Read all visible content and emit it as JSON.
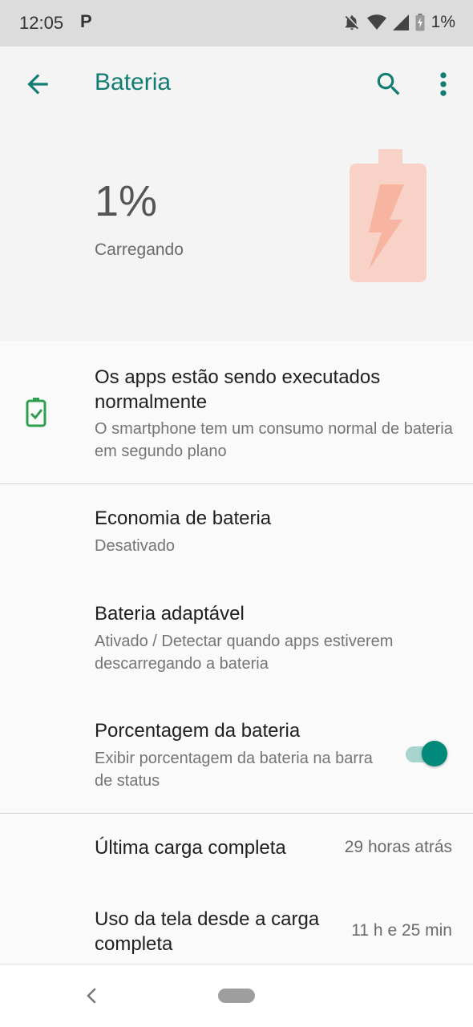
{
  "status_bar": {
    "time": "12:05",
    "notification_glyph": "P",
    "battery_text": "1%",
    "icons": [
      "notifications-off-icon",
      "wifi-icon",
      "signal-icon",
      "battery-charging-icon"
    ]
  },
  "app_bar": {
    "title": "Bateria",
    "back_icon": "arrow-back-icon",
    "search_icon": "search-icon",
    "more_icon": "more-vert-icon"
  },
  "hero": {
    "percent": "1%",
    "state": "Carregando",
    "battery_level": 0.01,
    "illustration_icon": "battery-charging-large-icon"
  },
  "tip": {
    "title": "Os apps estão sendo executados normalmente",
    "subtitle": "O smartphone tem um consumo normal de bateria em segundo plano",
    "icon": "battery-check-icon"
  },
  "settings": {
    "battery_saver": {
      "title": "Economia de bateria",
      "subtitle": "Desativado"
    },
    "adaptive_battery": {
      "title": "Bateria adaptável",
      "subtitle": "Ativado / Detectar quando apps estiverem descarregando a bateria"
    },
    "battery_percentage": {
      "title": "Porcentagem da bateria",
      "subtitle": "Exibir porcentagem da bateria na barra de status",
      "toggle_on": true
    }
  },
  "usage": {
    "last_full_charge": {
      "title": "Última carga completa",
      "value": "29 horas atrás"
    },
    "screen_usage": {
      "title": "Uso da tela desde a carga completa",
      "value": "11 h e 25 min"
    }
  },
  "colors": {
    "accent": "#127c72",
    "toggle_thumb": "#00897b",
    "toggle_track": "#a7d4cf",
    "tip_icon": "#2e9e4f",
    "battery_illustration": "#f8d2c6",
    "battery_bolt": "#f6b4a1"
  },
  "nav_bar": {
    "back_icon": "nav-back-icon",
    "home_pill": "home-pill"
  }
}
